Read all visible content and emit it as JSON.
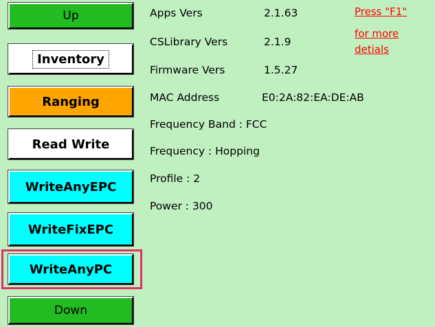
{
  "buttons": {
    "up": "Up",
    "inventory": "Inventory",
    "ranging": "Ranging",
    "read_write": "Read Write",
    "write_any_epc": "WriteAnyEPC",
    "write_fix_epc": "WriteFixEPC",
    "write_any_pc": "WriteAnyPC",
    "down": "Down"
  },
  "info": {
    "apps_vers": {
      "label": "Apps Vers",
      "value": "2.1.63"
    },
    "cslibrary_vers": {
      "label": "CSLibrary Vers",
      "value": "2.1.9"
    },
    "firmware_vers": {
      "label": "Firmware Vers",
      "value": "1.5.27"
    },
    "mac_address": {
      "label": "MAC Address",
      "value": "E0:2A:82:EA:DE:AB"
    },
    "frequency_band": "Frequency Band : FCC",
    "frequency": "Frequency : Hopping",
    "profile": "Profile : 2",
    "power": "Power : 300"
  },
  "help_link": {
    "line1": "Press \"F1\"",
    "line2": "for more",
    "line3": "detials"
  },
  "colors": {
    "background": "#c0f0c0",
    "nav_button": "#22bb22",
    "ranging": "#ffa500",
    "cyan_buttons": "#00ffff",
    "highlight": "#e0306a",
    "link": "#ff0000"
  }
}
